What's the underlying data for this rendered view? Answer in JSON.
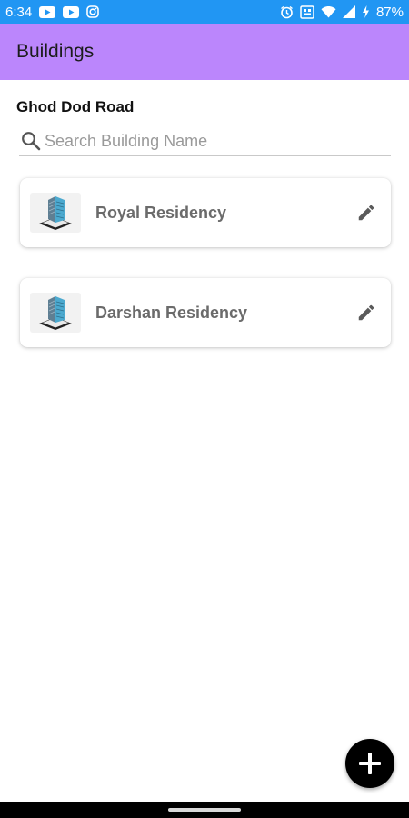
{
  "status_bar": {
    "time": "6:34",
    "battery": "87%",
    "background_color": "#2196f3",
    "left_icons": [
      "youtube-icon",
      "youtube-icon",
      "instagram-icon"
    ],
    "right_icons": [
      "alarm-icon",
      "data-saver-icon",
      "wifi-icon",
      "signal-icon",
      "battery-charging-icon"
    ]
  },
  "app_bar": {
    "title": "Buildings",
    "background_color": "#bb86fc"
  },
  "location": {
    "label": "Ghod Dod Road"
  },
  "search": {
    "placeholder": "Search Building Name",
    "value": ""
  },
  "buildings": [
    {
      "name": "Royal Residency",
      "thumbnail": "building-icon",
      "action": "edit-icon"
    },
    {
      "name": "Darshan Residency",
      "thumbnail": "building-icon",
      "action": "edit-icon"
    }
  ],
  "fab": {
    "icon": "plus-icon",
    "color": "#000000"
  }
}
